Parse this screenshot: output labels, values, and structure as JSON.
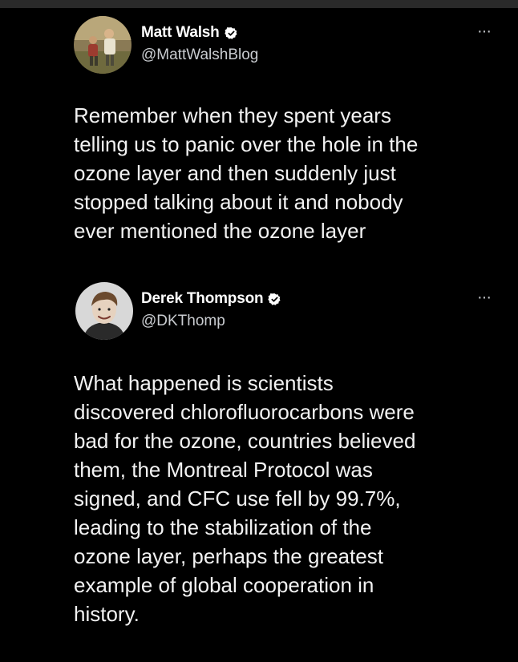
{
  "tweets": [
    {
      "author": {
        "display_name": "Matt Walsh",
        "handle": "@MattWalshBlog",
        "verified": true,
        "avatar_icon": "avatar-photo-outdoor"
      },
      "more_label": "···",
      "text": "Remember when they spent years\ntelling us to panic over the hole in the\nozone layer and then suddenly just\nstopped talking about it and nobody\never mentioned the ozone layer"
    },
    {
      "author": {
        "display_name": "Derek Thompson",
        "handle": "@DKThomp",
        "verified": true,
        "avatar_icon": "avatar-photo-portrait"
      },
      "more_label": "···",
      "text": "What happened is scientists\ndiscovered chlorofluorocarbons were\nbad for the ozone, countries believed\nthem, the Montreal Protocol was\nsigned, and CFC use fell by 99.7%,\nleading to the stabilization of the\nozone layer, perhaps the greatest\nexample of global cooperation in\nhistory."
    }
  ],
  "colors": {
    "background": "#000000",
    "text": "#f2f2f2",
    "secondary_text": "#c9ccd0",
    "verified_badge": "#ffffff"
  }
}
